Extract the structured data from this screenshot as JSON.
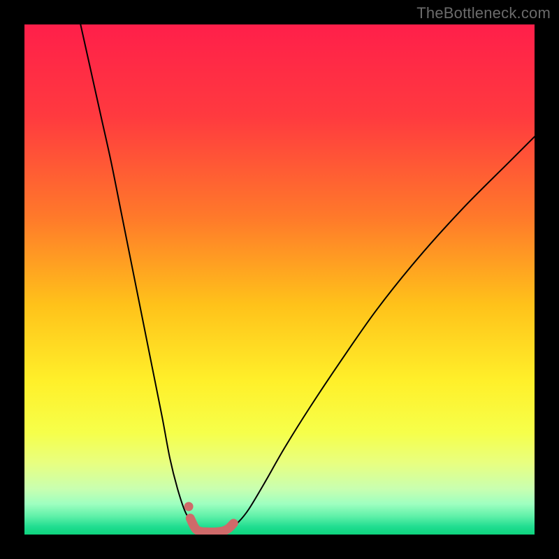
{
  "watermark": "TheBottleneck.com",
  "colors": {
    "frame": "#000000",
    "curve": "#000000",
    "marker": "#cf6a6a",
    "gradient_stops": [
      {
        "offset": 0.0,
        "color": "#ff1f4a"
      },
      {
        "offset": 0.18,
        "color": "#ff3a3f"
      },
      {
        "offset": 0.38,
        "color": "#ff7a2a"
      },
      {
        "offset": 0.55,
        "color": "#ffc21a"
      },
      {
        "offset": 0.7,
        "color": "#fff02a"
      },
      {
        "offset": 0.8,
        "color": "#f6ff4a"
      },
      {
        "offset": 0.86,
        "color": "#e8ff80"
      },
      {
        "offset": 0.91,
        "color": "#c9ffb0"
      },
      {
        "offset": 0.94,
        "color": "#9effc0"
      },
      {
        "offset": 0.965,
        "color": "#5df0a8"
      },
      {
        "offset": 0.985,
        "color": "#20dd90"
      },
      {
        "offset": 1.0,
        "color": "#0ed47e"
      }
    ]
  },
  "chart_data": {
    "type": "line",
    "title": "",
    "xlabel": "",
    "ylabel": "",
    "xlim": [
      0,
      100
    ],
    "ylim": [
      0,
      100
    ],
    "grid": false,
    "series": [
      {
        "name": "left-curve",
        "x": [
          11,
          13,
          15,
          17,
          19,
          21,
          23,
          25,
          27,
          28.5,
          30,
          31.5,
          33,
          33.5
        ],
        "values": [
          100,
          91,
          82,
          73,
          63,
          53,
          43,
          33,
          23,
          15,
          9,
          4.5,
          2,
          1.2
        ]
      },
      {
        "name": "right-curve",
        "x": [
          40.5,
          42,
          44,
          47,
          51,
          56,
          62,
          69,
          77,
          86,
          95,
          100
        ],
        "values": [
          1.4,
          2.5,
          5,
          10,
          17,
          25,
          34,
          44,
          54,
          64,
          73,
          78
        ]
      },
      {
        "name": "trough-highlight",
        "x": [
          32.5,
          33.5,
          34.5,
          36,
          37.5,
          39,
          40,
          41
        ],
        "values": [
          3.2,
          1.2,
          0.6,
          0.5,
          0.5,
          0.7,
          1.2,
          2.2
        ]
      }
    ],
    "annotations": []
  }
}
